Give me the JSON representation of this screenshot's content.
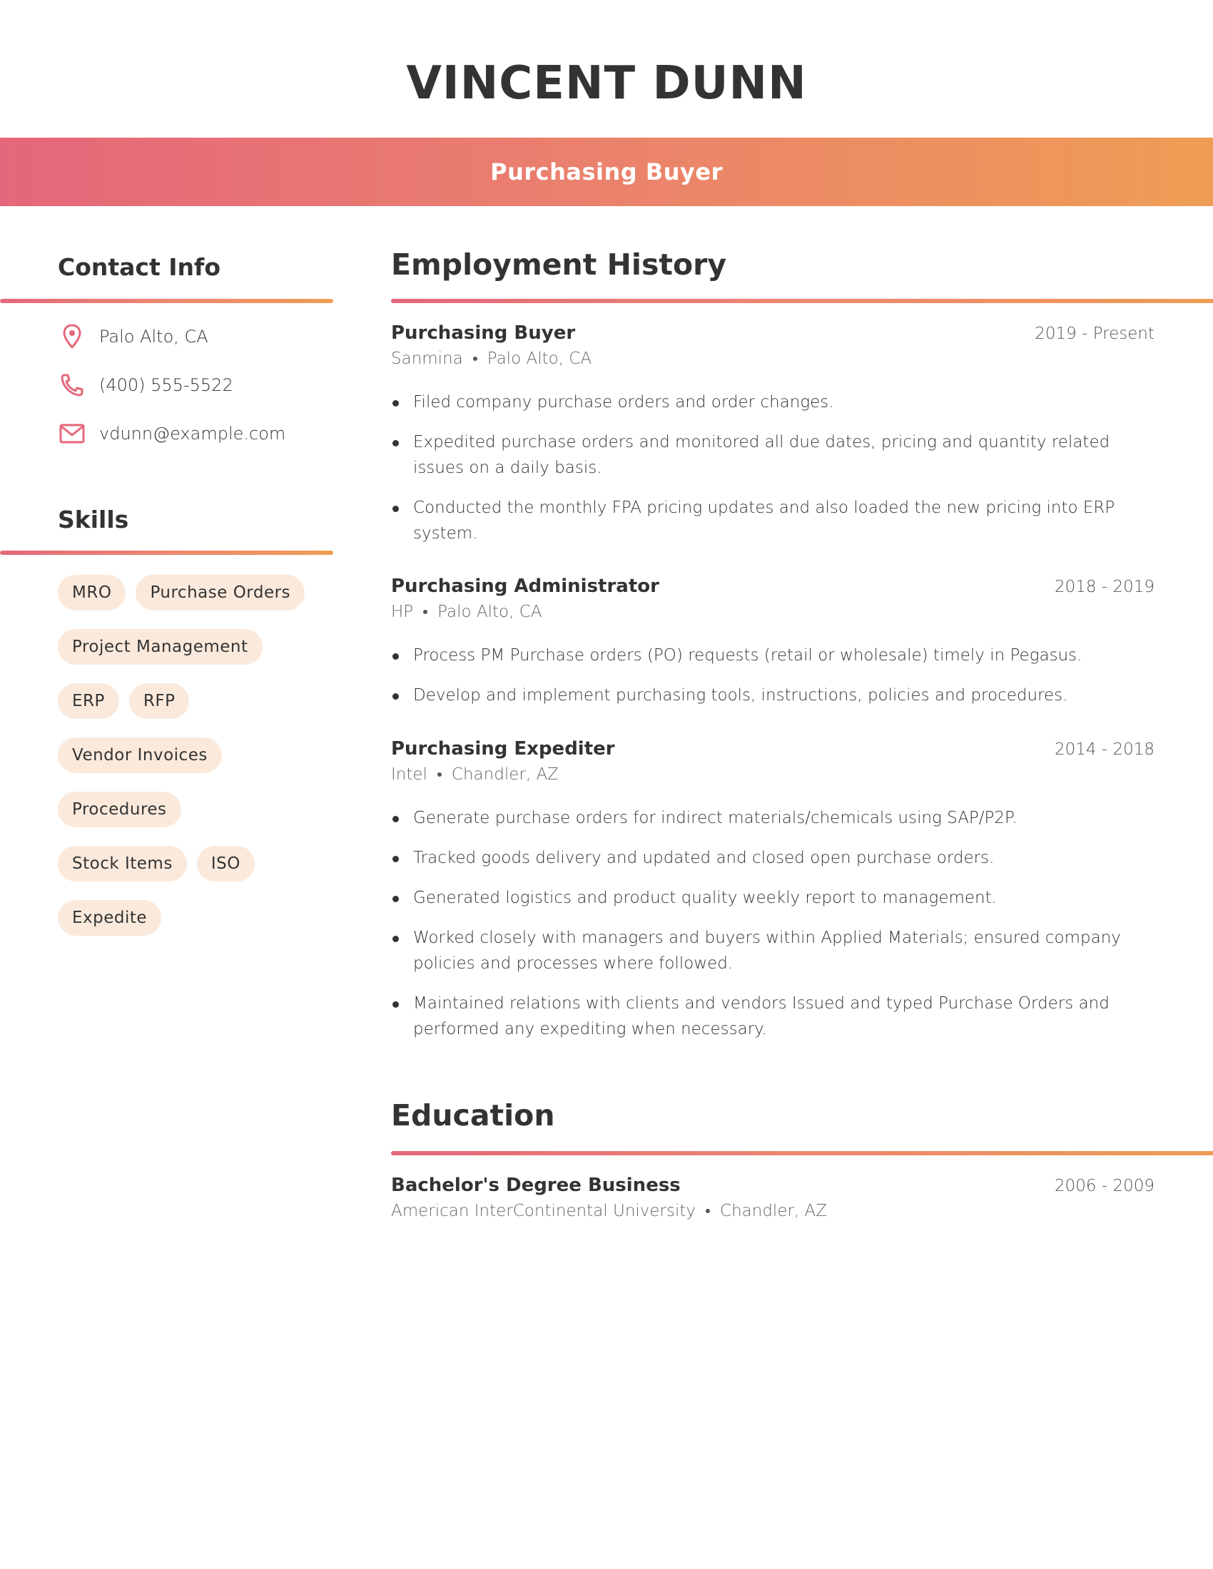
{
  "header": {
    "name": "VINCENT DUNN",
    "title": "Purchasing Buyer"
  },
  "colors": {
    "gradient_start": "#e5677b",
    "gradient_end": "#ef9d55",
    "chip_bg": "#fbeadc",
    "text": "#333333",
    "icon": "#e5677b"
  },
  "contact": {
    "heading": "Contact Info",
    "items": [
      {
        "icon": "location-pin-icon",
        "text": "Palo Alto, CA"
      },
      {
        "icon": "phone-icon",
        "text": "(400) 555-5522"
      },
      {
        "icon": "email-icon",
        "text": "vdunn@example.com"
      }
    ]
  },
  "skills": {
    "heading": "Skills",
    "items": [
      "MRO",
      "Purchase Orders",
      "Project Management",
      "ERP",
      "RFP",
      "Vendor Invoices",
      "Procedures",
      "Stock Items",
      "ISO",
      "Expedite"
    ]
  },
  "employment": {
    "heading": "Employment History",
    "jobs": [
      {
        "title": "Purchasing Buyer",
        "dates": "2019 - Present",
        "company": "Sanmina",
        "location": "Palo Alto, CA",
        "bullets": [
          "Filed company purchase orders and order changes.",
          "Expedited purchase orders and monitored all due dates, pricing and quantity related issues on a daily basis.",
          "Conducted the monthly FPA pricing updates and also loaded the new pricing into ERP system."
        ]
      },
      {
        "title": "Purchasing Administrator",
        "dates": "2018 - 2019",
        "company": "HP",
        "location": "Palo Alto, CA",
        "bullets": [
          "Process PM Purchase orders (PO) requests (retail or wholesale) timely in Pegasus.",
          "Develop and implement purchasing tools, instructions, policies and procedures."
        ]
      },
      {
        "title": "Purchasing Expediter",
        "dates": "2014 - 2018",
        "company": "Intel",
        "location": "Chandler, AZ",
        "bullets": [
          "Generate purchase orders for indirect materials/chemicals using SAP/P2P.",
          "Tracked goods delivery and updated and closed open purchase orders.",
          "Generated logistics and product quality weekly report to management.",
          "Worked closely with managers and buyers within Applied Materials; ensured company policies and processes where followed.",
          "Maintained relations with clients and vendors Issued and typed Purchase Orders and performed any expediting when necessary."
        ]
      }
    ]
  },
  "education": {
    "heading": "Education",
    "entries": [
      {
        "degree": "Bachelor's Degree Business",
        "dates": "2006 - 2009",
        "school": "American InterContinental University",
        "location": "Chandler, AZ"
      }
    ]
  }
}
